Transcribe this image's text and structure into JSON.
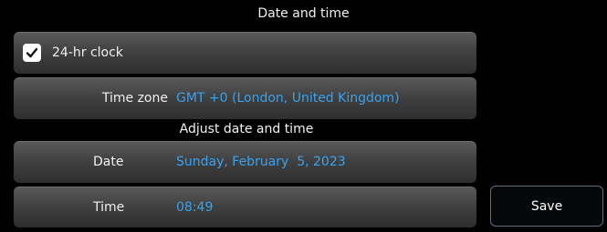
{
  "header": {
    "title": "Date and time"
  },
  "clock": {
    "label": "24-hr clock",
    "checked": true
  },
  "timezone": {
    "label": "Time zone",
    "value": "GMT +0 (London, United Kingdom)"
  },
  "section": {
    "title": "Adjust date and time"
  },
  "date": {
    "label": "Date",
    "value": "Sunday, February  5, 2023"
  },
  "time": {
    "label": "Time",
    "value": "08:49"
  },
  "actions": {
    "save_label": "Save"
  },
  "colors": {
    "value_accent": "#3aa2ee",
    "background": "#000000"
  },
  "icons": {
    "checkbox": "checkmark-icon"
  }
}
